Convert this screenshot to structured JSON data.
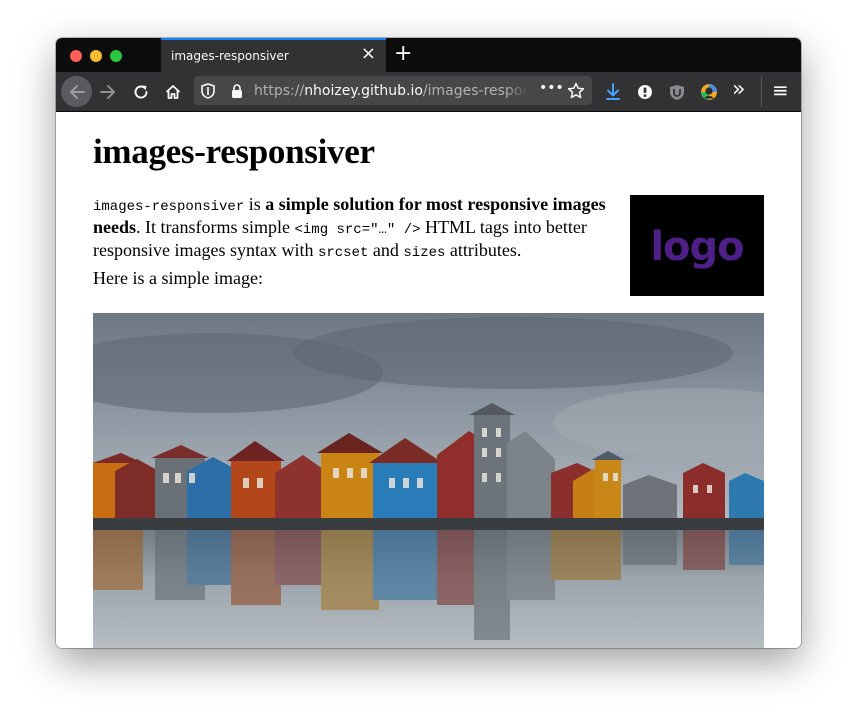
{
  "browser": {
    "tab_title": "images-responsiver",
    "tab_close": "×",
    "new_tab": "+",
    "url_scheme": "https://",
    "url_host": "nhoizey.github.io",
    "url_path": "/images-responsiver/",
    "page_actions": "•••",
    "overflow": "»",
    "menu": "≡"
  },
  "icons": [
    "back-icon",
    "forward-icon",
    "reload-icon",
    "home-icon",
    "shield-icon",
    "lock-icon",
    "star-icon",
    "download-icon",
    "extension-icon",
    "ublock-icon",
    "avatar-icon",
    "menu-icon"
  ],
  "page": {
    "title": "images-responsiver",
    "intro_code": "images-responsiver",
    "intro_is": " is ",
    "intro_bold": "a simple solution for most responsive images needs",
    "intro_mid": ". It transforms simple ",
    "intro_img_tag": "<img src=\"…\" />",
    "intro_mid2": " HTML tags into better responsive images syntax with ",
    "intro_srcset": "srcset",
    "intro_and": " and ",
    "intro_sizes": "sizes",
    "intro_end": " attributes.",
    "simple_image_text": "Here is a simple image:",
    "logo_text": "logo"
  },
  "colors": {
    "accent": "#0a84ff",
    "logo_bg": "#000000",
    "logo_text": "#4d1f87",
    "toolbar": "#323234",
    "tabstrip": "#0c0c0d"
  }
}
